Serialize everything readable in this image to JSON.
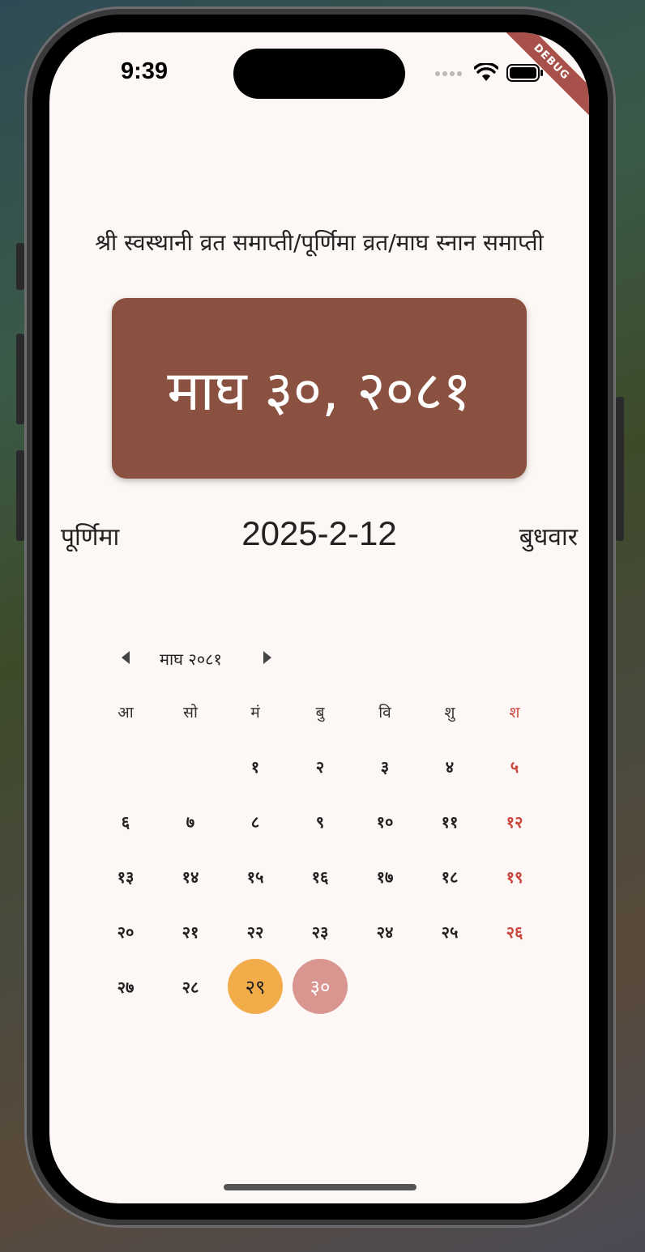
{
  "status": {
    "time": "9:39",
    "debug_label": "DEBUG"
  },
  "event_title": "श्री स्वस्थानी व्रत समाप्ती/पूर्णिमा व्रत/माघ स्नान समाप्ती",
  "nepali_date": "माघ ३०, २०८१",
  "tithi": "पूर्णिमा",
  "gregorian_date": "2025-2-12",
  "weekday_name": "बुधवार",
  "calendar": {
    "month_label": "माघ २०८१",
    "weekdays": [
      "आ",
      "सो",
      "मं",
      "बु",
      "वि",
      "शु",
      "श"
    ],
    "first_weekday_index": 2,
    "days": [
      "१",
      "२",
      "३",
      "४",
      "५",
      "६",
      "७",
      "८",
      "९",
      "१०",
      "११",
      "१२",
      "१३",
      "१४",
      "१५",
      "१६",
      "१७",
      "१८",
      "१९",
      "२०",
      "२१",
      "२२",
      "२३",
      "२४",
      "२५",
      "२६",
      "२७",
      "२८",
      "२९",
      "३०"
    ],
    "today_day": 29,
    "selected_day": 30
  },
  "colors": {
    "card": "#8a5140",
    "today_circle": "#f2ad4a",
    "selected_circle": "#d99590",
    "saturday_text": "#c9473d",
    "background": "#fdf7f5"
  }
}
